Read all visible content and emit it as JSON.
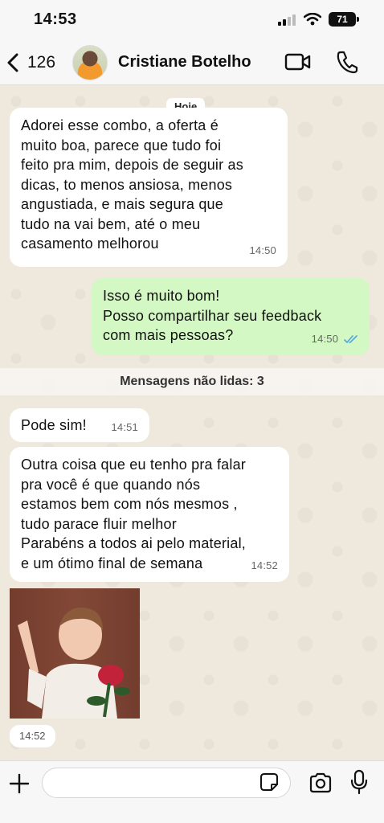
{
  "status_bar": {
    "time": "14:53",
    "battery": "71"
  },
  "header": {
    "back_count": "126",
    "contact_name": "Cristiane Botelho"
  },
  "chat": {
    "date_chip": "Hoje",
    "messages": [
      {
        "direction": "incoming",
        "text": "Adorei esse combo, a oferta é\nmuito boa, parece que tudo foi\nfeito pra mim, depois de seguir as\ndicas, to menos ansiosa, menos\nangustiada, e mais segura que\ntudo na vai bem, até o meu\ncasamento melhorou",
        "time": "14:50"
      },
      {
        "direction": "outgoing",
        "text": "Isso é muito bom!\nPosso compartilhar seu feedback\ncom mais pessoas?",
        "time": "14:50",
        "status": "read"
      },
      {
        "direction": "incoming",
        "text": "Pode sim!",
        "time": "14:51"
      },
      {
        "direction": "incoming",
        "text": "Outra coisa que eu tenho pra falar\npra você é que quando nós\nestamos bem com nós mesmos ,\ntudo parace fluir melhor\nParabéns a todos ai pelo material,\ne um ótimo final de semana",
        "time": "14:52"
      }
    ],
    "unread_banner": "Mensagens não lidas: 3",
    "sticker_time": "14:52"
  },
  "input_bar": {
    "placeholder": ""
  },
  "colors": {
    "outgoing_bubble": "#d4f8c4",
    "incoming_bubble": "#ffffff",
    "chat_background": "#efe8dd",
    "read_ticks": "#4fa3e0"
  }
}
